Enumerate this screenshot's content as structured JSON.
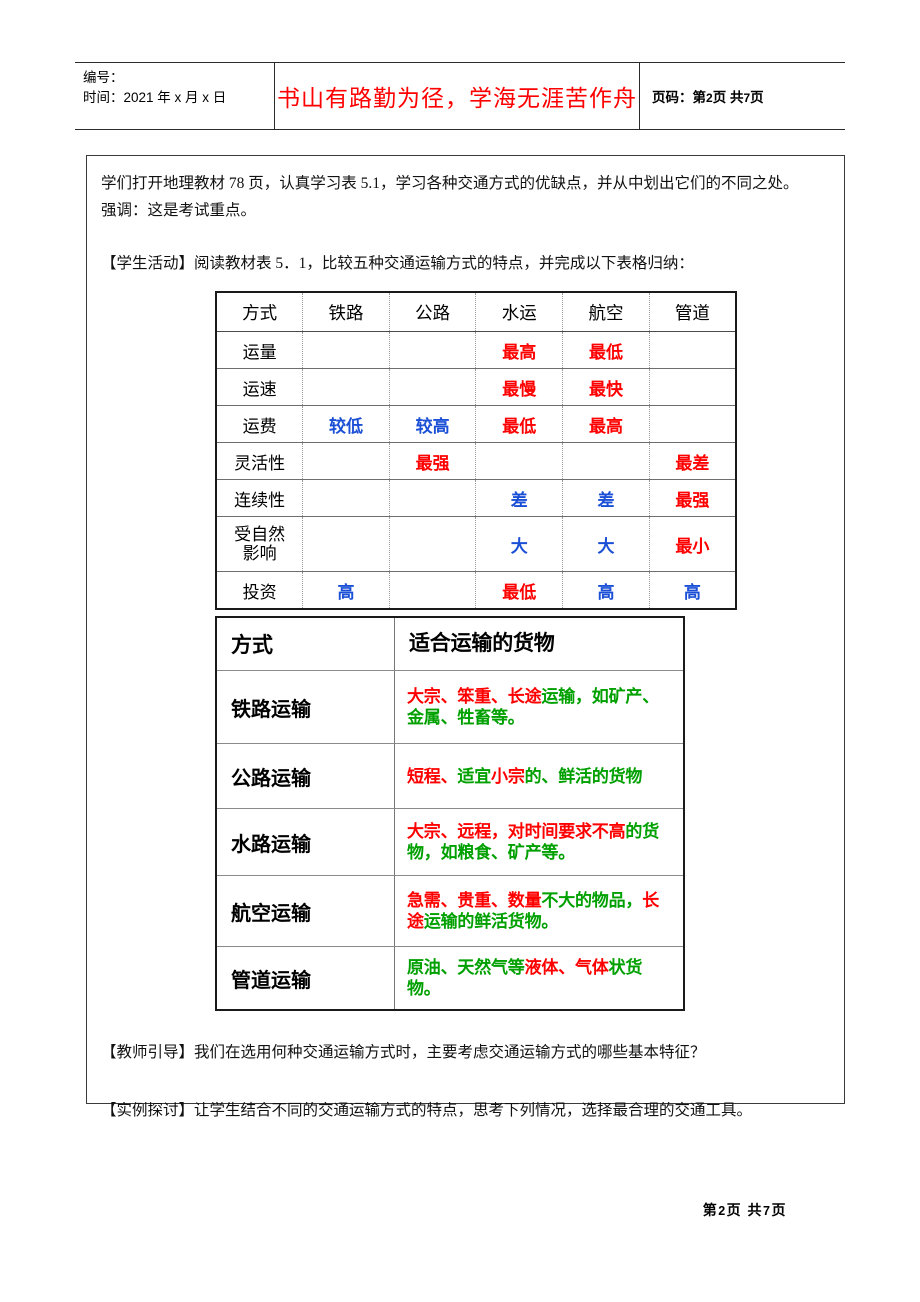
{
  "header": {
    "serial_label": "编号：",
    "time_label": "时间：2021 年 x 月 x 日",
    "motto": "书山有路勤为径，学海无涯苦作舟",
    "page_prefix": "页码：第",
    "page_current": "2",
    "page_mid": "页 共",
    "page_total": "7",
    "page_suffix": "页"
  },
  "content": {
    "intro_line1": "学们打开地理教材 78 页，认真学习表 5.1，学习各种交通方式的优缺点，并从中划出它们的不同之处。",
    "intro_line2": "强调：这是考试重点。",
    "activity": "【学生活动】阅读教材表 5．1，比较五种交通运输方式的特点，并完成以下表格归纳：",
    "teacher_guide": "【教师引导】我们在选用何种交通运输方式时，主要考虑交通运输方式的哪些基本特征？",
    "case_study": "【实例探讨】让学生结合不同的交通运输方式的特点，思考下列情况，选择最合理的交通工具。"
  },
  "comparison_table": {
    "columns": [
      "方式",
      "铁路",
      "公路",
      "水运",
      "航空",
      "管道"
    ],
    "rows": [
      {
        "label": "运量",
        "cells": [
          {
            "text": "",
            "color": ""
          },
          {
            "text": "",
            "color": ""
          },
          {
            "text": "最高",
            "color": "#ff0000"
          },
          {
            "text": "最低",
            "color": "#ff0000"
          },
          {
            "text": "",
            "color": ""
          }
        ]
      },
      {
        "label": "运速",
        "cells": [
          {
            "text": "",
            "color": ""
          },
          {
            "text": "",
            "color": ""
          },
          {
            "text": "最慢",
            "color": "#ff0000"
          },
          {
            "text": "最快",
            "color": "#ff0000"
          },
          {
            "text": "",
            "color": ""
          }
        ]
      },
      {
        "label": "运费",
        "cells": [
          {
            "text": "较低",
            "color": "#1a4fd6"
          },
          {
            "text": "较高",
            "color": "#1a4fd6"
          },
          {
            "text": "最低",
            "color": "#ff0000"
          },
          {
            "text": "最高",
            "color": "#ff0000"
          },
          {
            "text": "",
            "color": ""
          }
        ]
      },
      {
        "label": "灵活性",
        "cells": [
          {
            "text": "",
            "color": ""
          },
          {
            "text": "最强",
            "color": "#ff0000"
          },
          {
            "text": "",
            "color": ""
          },
          {
            "text": "",
            "color": ""
          },
          {
            "text": "最差",
            "color": "#ff0000"
          }
        ]
      },
      {
        "label": "连续性",
        "cells": [
          {
            "text": "",
            "color": ""
          },
          {
            "text": "",
            "color": ""
          },
          {
            "text": "差",
            "color": "#1a4fd6"
          },
          {
            "text": "差",
            "color": "#1a4fd6"
          },
          {
            "text": "最强",
            "color": "#ff0000"
          }
        ]
      },
      {
        "label": "受自然\n影响",
        "label_line1": "受自然",
        "label_line2": "影响",
        "cells": [
          {
            "text": "",
            "color": ""
          },
          {
            "text": "",
            "color": ""
          },
          {
            "text": "大",
            "color": "#1a4fd6"
          },
          {
            "text": "大",
            "color": "#1a4fd6"
          },
          {
            "text": "最小",
            "color": "#ff0000"
          }
        ]
      },
      {
        "label": "投资",
        "cells": [
          {
            "text": "高",
            "color": "#1a4fd6"
          },
          {
            "text": "",
            "color": ""
          },
          {
            "text": "最低",
            "color": "#ff0000"
          },
          {
            "text": "高",
            "color": "#1a4fd6"
          },
          {
            "text": "高",
            "color": "#1a4fd6"
          }
        ]
      }
    ]
  },
  "cargo_table": {
    "header": {
      "mode": "方式",
      "cargo": "适合运输的货物"
    },
    "rows": [
      {
        "mode": "铁路运输",
        "segments": [
          {
            "text": "大宗、笨重、长途",
            "color": "#ff0000"
          },
          {
            "text": "运输，如矿产、金属、牲畜等。",
            "color": "#00a000"
          }
        ]
      },
      {
        "mode": "公路运输",
        "segments": [
          {
            "text": "短程、",
            "color": "#ff0000"
          },
          {
            "text": "适宜",
            "color": "#00a000"
          },
          {
            "text": "小宗",
            "color": "#ff0000"
          },
          {
            "text": "的、鲜活的货物",
            "color": "#00a000"
          }
        ]
      },
      {
        "mode": "水路运输",
        "segments": [
          {
            "text": "大宗、远程，对时间要求不高",
            "color": "#ff0000"
          },
          {
            "text": "的货物，如粮食、矿产等。",
            "color": "#00a000"
          }
        ]
      },
      {
        "mode": "航空运输",
        "segments": [
          {
            "text": "急需、贵重、数量",
            "color": "#ff0000"
          },
          {
            "text": "不大的物品，",
            "color": "#00a000"
          },
          {
            "text": "长途",
            "color": "#ff0000"
          },
          {
            "text": "运输的鲜活货物。",
            "color": "#00a000"
          }
        ]
      },
      {
        "mode": "管道运输",
        "segments": [
          {
            "text": "原油、天然气等",
            "color": "#00a000"
          },
          {
            "text": "液体、气体",
            "color": "#ff0000"
          },
          {
            "text": "状货物。",
            "color": "#00a000"
          }
        ]
      }
    ]
  },
  "footer": {
    "prefix": "第",
    "current": "2",
    "mid": "页 共",
    "total": "7",
    "suffix": "页"
  },
  "colors": {
    "red": "#ff0000",
    "blue": "#1a4fd6",
    "green": "#00a000",
    "rule": "#2b2b2b"
  }
}
